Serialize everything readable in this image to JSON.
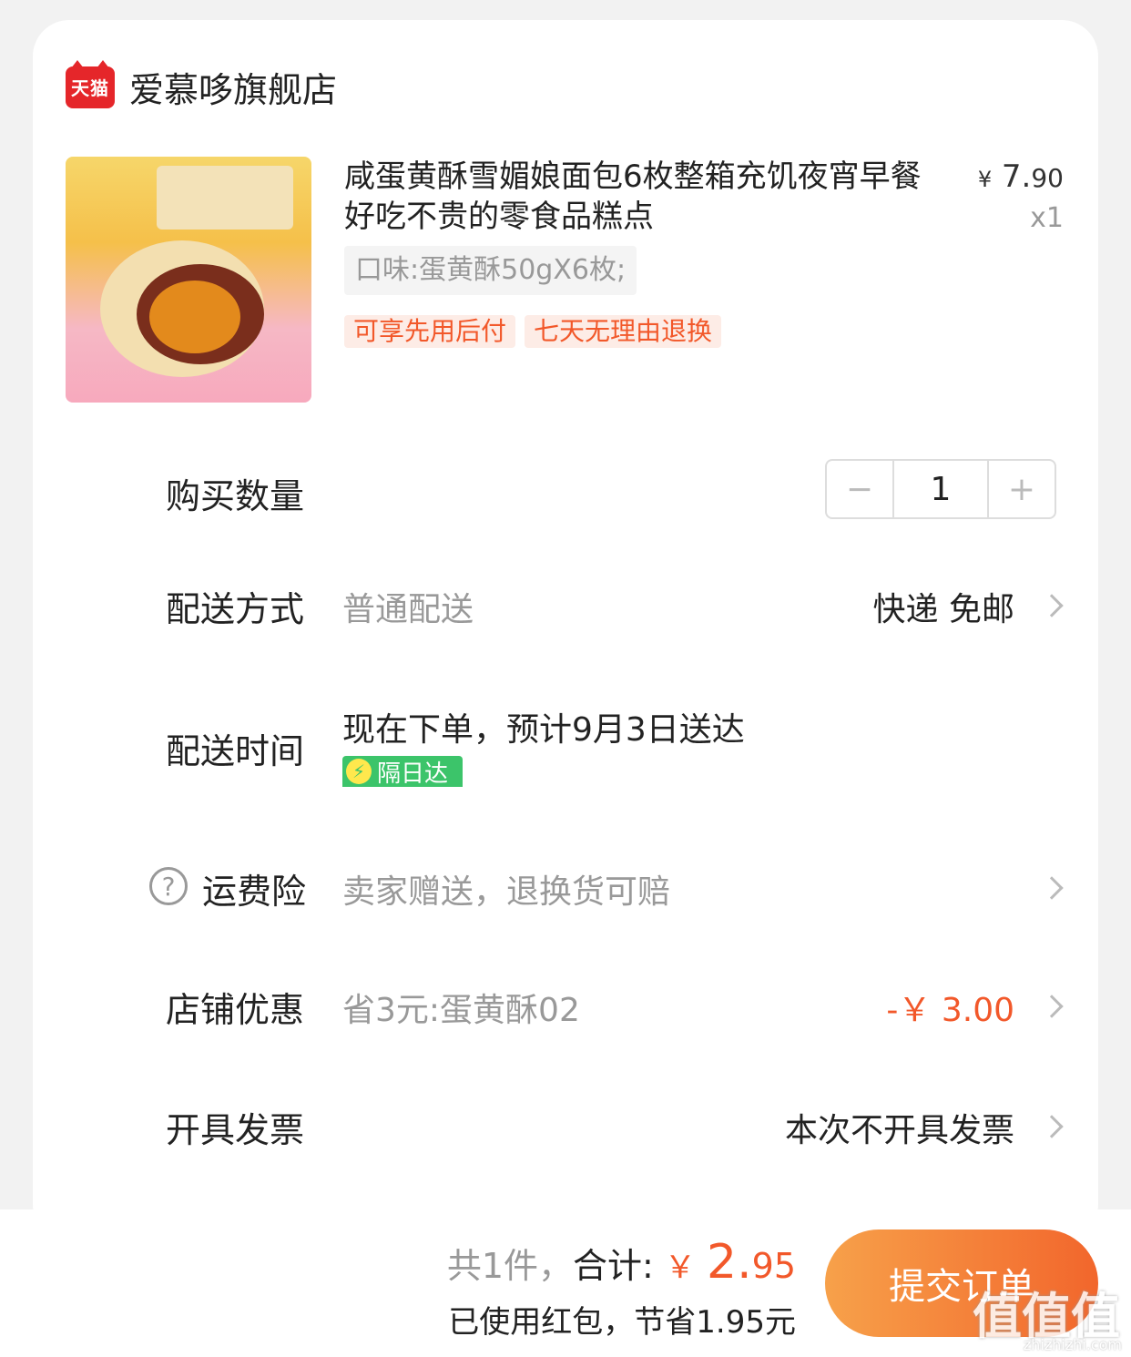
{
  "shop": {
    "logo_text": "天猫",
    "name": "爱慕哆旗舰店"
  },
  "product": {
    "title": "咸蛋黄酥雪媚娘面包6枚整箱充饥夜宵早餐好吃不贵的零食品糕点",
    "price_symbol": "¥",
    "price_int": "7.",
    "price_dec": "90",
    "quantity_label": "x1",
    "spec": "口味:蛋黄酥50gX6枚;",
    "tags": [
      "可享先用后付",
      "七天无理由退换"
    ]
  },
  "purchase_qty": {
    "label": "购买数量",
    "minus": "−",
    "value": "1",
    "plus": "+"
  },
  "delivery": {
    "label": "配送方式",
    "method": "普通配送",
    "value": "快递 免邮"
  },
  "delivery_time": {
    "label": "配送时间",
    "estimate": "现在下单，预计9月3日送达",
    "badge_icon": "⚡",
    "badge": "隔日达"
  },
  "freight_insurance": {
    "label": "运费险",
    "help_icon": "?",
    "desc": "卖家赠送，退换货可赔"
  },
  "shop_discount": {
    "label": "店铺优惠",
    "desc": "省3元:蛋黄酥02",
    "value": "-￥ 3.00"
  },
  "invoice": {
    "label": "开具发票",
    "value": "本次不开具发票"
  },
  "footer": {
    "count": "共1件，",
    "total_label": "合计:",
    "total_symbol": "￥",
    "total_int": "2.",
    "total_dec": "95",
    "saved": "已使用红包，节省1.95元",
    "submit": "提交订单"
  },
  "watermark": {
    "text": "值值值",
    "url": "zhizhizhi.com"
  },
  "colors": {
    "accent": "#f2582a",
    "brand_red": "#e5262a",
    "green": "#3cc46a"
  }
}
